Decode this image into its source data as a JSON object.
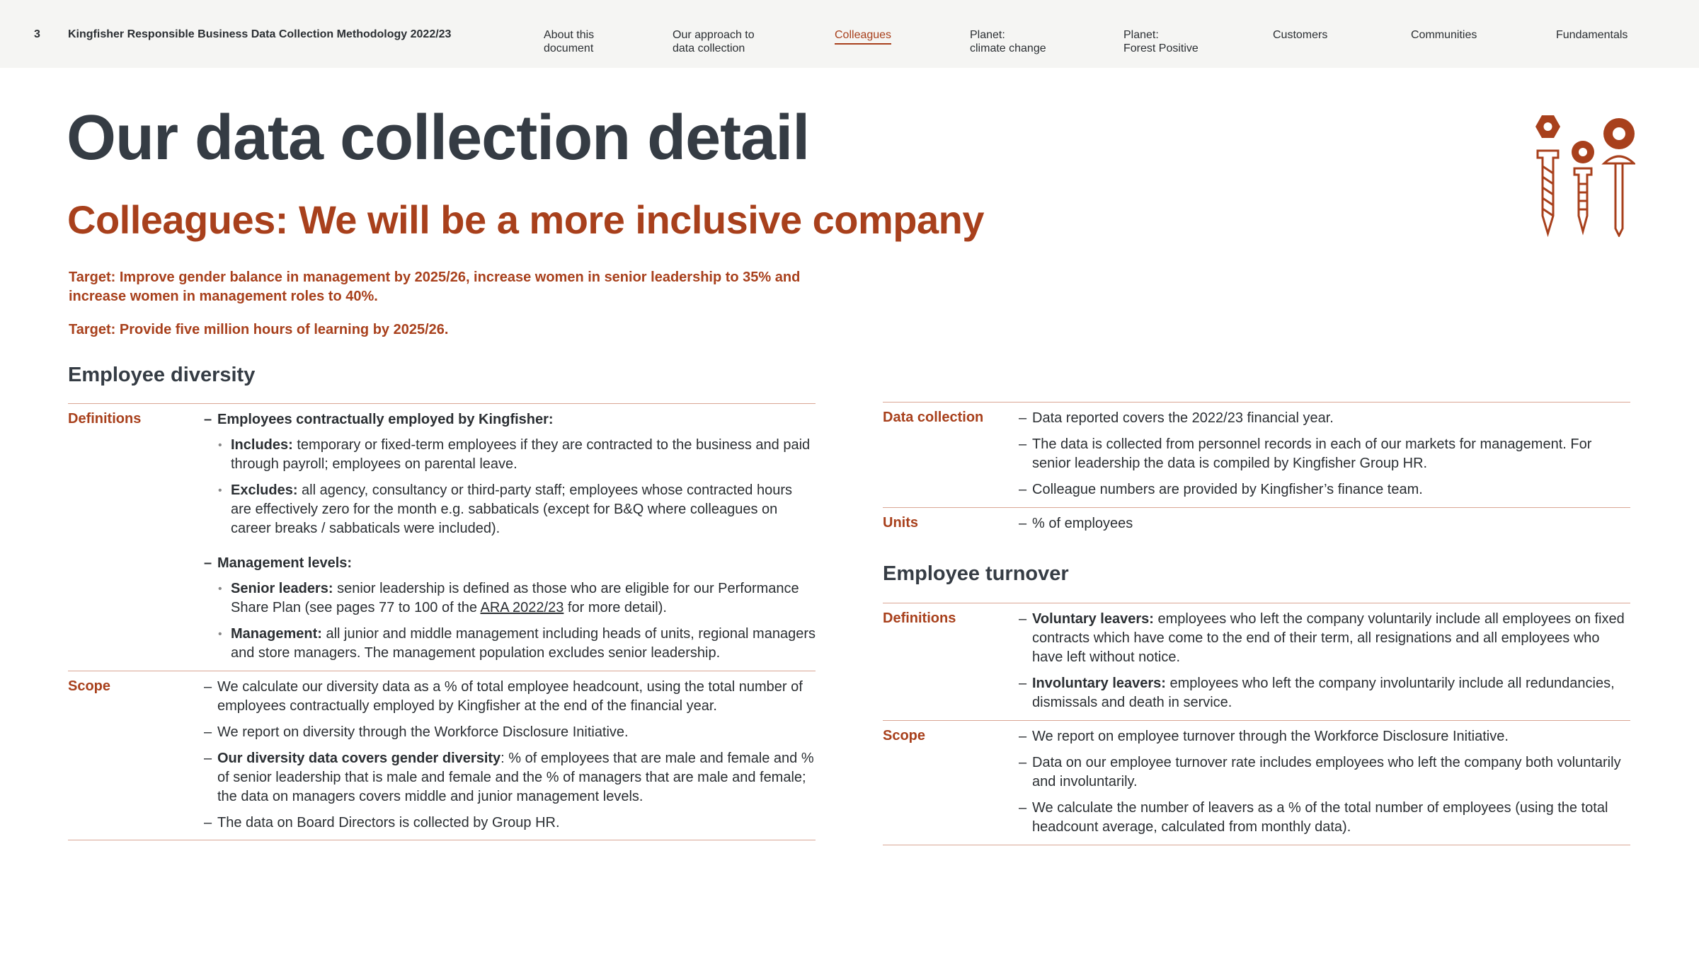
{
  "header": {
    "page_number": "3",
    "doc_title": "Kingfisher Responsible Business Data Collection Methodology 2022/23",
    "nav": [
      {
        "l1": "About this",
        "l2": "document"
      },
      {
        "l1": "Our approach to",
        "l2": "data collection"
      },
      {
        "l1": "Colleagues",
        "l2": ""
      },
      {
        "l1": "Planet:",
        "l2": "climate change"
      },
      {
        "l1": "Planet:",
        "l2": "Forest Positive"
      },
      {
        "l1": "Customers",
        "l2": ""
      },
      {
        "l1": "Communities",
        "l2": ""
      },
      {
        "l1": "Fundamentals",
        "l2": ""
      }
    ]
  },
  "page": {
    "title": "Our data collection detail",
    "subtitle": "Colleagues: We will be a more inclusive company",
    "target_1": "Target: Improve gender balance in management by 2025/26, increase women in senior leadership to 35% and increase women in management roles to 40%.",
    "target_2": "Target: Provide five million hours of learning by 2025/26."
  },
  "diversity": {
    "title": "Employee diversity",
    "definitions": {
      "label": "Definitions",
      "head_1": "Employees contractually employed by Kingfisher:",
      "includes_label": "Includes:",
      "includes_text": " temporary or fixed-term employees if they are contracted to the business and paid through payroll; employees on parental leave.",
      "excludes_label": "Excludes:",
      "excludes_text": " all agency, consultancy or third-party staff; employees whose contracted hours are effectively zero for the month e.g. sabbaticals (except for B&Q where colleagues on career breaks / sabbaticals were included).",
      "head_2": "Management levels:",
      "senior_label": "Senior leaders:",
      "senior_text_a": " senior leadership is defined as those who are eligible for our Performance Share Plan (see pages 77 to 100 of the ",
      "senior_link": "ARA 2022/23",
      "senior_text_b": " for more detail).",
      "mgmt_label": "Management:",
      "mgmt_text": " all junior and middle management including heads of units, regional managers and store managers. The management population excludes senior leadership."
    },
    "scope": {
      "label": "Scope",
      "item_1": "We calculate our diversity data as a % of total employee headcount, using the total number of employees contractually employed by Kingfisher at the end of the financial year.",
      "item_2": "We report on diversity through the Workforce Disclosure Initiative.",
      "item_3_label": "Our diversity data covers gender diversity",
      "item_3_text": ": % of employees that are male and female and % of senior leadership that is male and female and the % of managers that are male and female; the data on managers covers middle and junior management levels.",
      "item_4": "The data on Board Directors is collected by Group HR."
    },
    "data_collection": {
      "label": "Data collection",
      "item_1": "Data reported covers the 2022/23 financial year.",
      "item_2": "The data is collected from personnel records in each of our markets for management. For senior leadership the data is compiled by Kingfisher Group HR.",
      "item_3": "Colleague numbers are provided by Kingfisher’s finance team."
    },
    "units": {
      "label": "Units",
      "item_1": "% of employees"
    }
  },
  "turnover": {
    "title": "Employee turnover",
    "definitions": {
      "label": "Definitions",
      "vol_label": "Voluntary leavers:",
      "vol_text": " employees who left the company voluntarily include all employees on fixed contracts which have come to the end of their term, all resignations and all employees who have left without notice.",
      "invol_label": "Involuntary leavers:",
      "invol_text": " employees who left the company involuntarily include all redundancies, dismissals and death in service."
    },
    "scope": {
      "label": "Scope",
      "item_1": "We report on employee turnover through the Workforce Disclosure Initiative.",
      "item_2": "Data on our employee turnover rate includes employees who left the company both voluntarily and involuntarily.",
      "item_3": "We calculate the number of leavers as a % of the total number of employees (using the total headcount average, calculated from monthly data)."
    }
  },
  "colors": {
    "accent": "#a8401c",
    "heading": "#353c44",
    "rule": "#d9a593",
    "header_bg": "#f5f5f3"
  },
  "icons": [
    "nut-and-screws-icon"
  ]
}
